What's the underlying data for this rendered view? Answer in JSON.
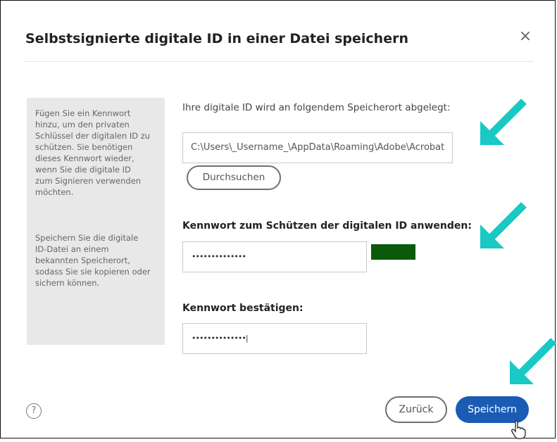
{
  "dialog": {
    "title": "Selbstsignierte digitale ID in einer Datei speichern",
    "close_glyph": "×"
  },
  "sidebar": {
    "paragraph1": "Fügen Sie ein Kennwort\nhinzu, um den privaten\nSchlüssel der digitalen ID zu\nschützen. Sie benötigen\ndieses Kennwort wieder,\nwenn Sie die digitale ID\nzum Signieren verwenden\nmöchten.",
    "paragraph2": "Speichern Sie die digitale\nID-Datei an einem\nbekannten Speicherort,\nsodass Sie sie kopieren oder\nsichern können."
  },
  "location": {
    "label": "Ihre digitale ID wird an folgendem Speicherort abgelegt:",
    "path_value": "C:\\Users\\_Username_\\AppData\\Roaming\\Adobe\\Acrobat",
    "browse_label": "Durchsuchen"
  },
  "password": {
    "label": "Kennwort zum Schützen der digitalen ID anwenden:",
    "value": "••••••••••••••",
    "strength_color": "#0b5a0b"
  },
  "confirm": {
    "label": "Kennwort bestätigen:",
    "value": "••••••••••••••|"
  },
  "footer": {
    "help_glyph": "?",
    "back_label": "Zurück",
    "save_label": "Speichern"
  },
  "colors": {
    "primary_button": "#1a5cb4",
    "annotation_arrow": "#19c9c4",
    "sidebar_bg": "#e8e8e8"
  },
  "icons": [
    "close-icon",
    "help-icon",
    "hand-cursor-icon",
    "annotation-arrow-icon"
  ]
}
